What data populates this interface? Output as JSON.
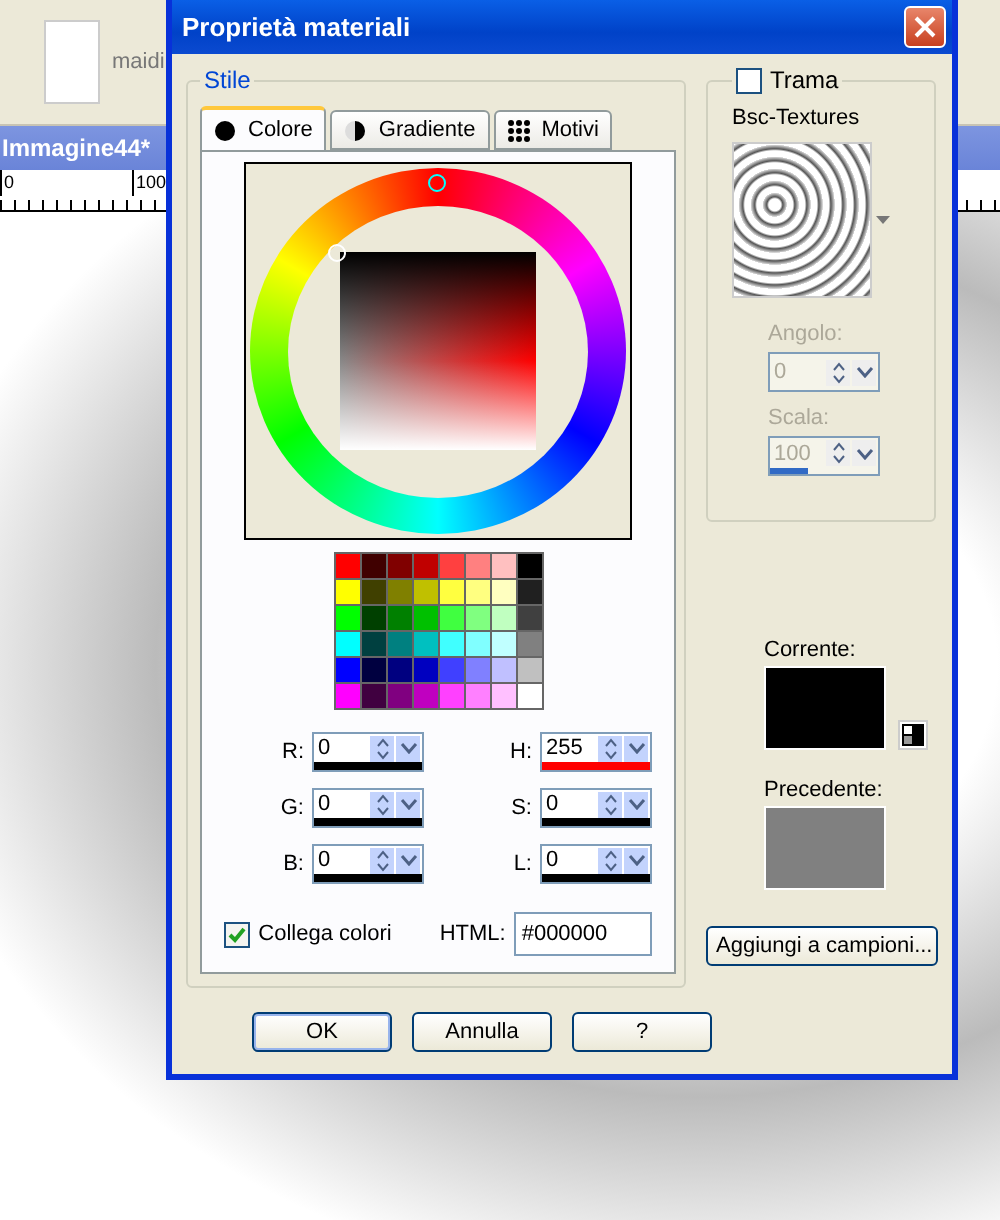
{
  "background_app": {
    "toolbar_text": "maidi",
    "document_tab": "Immagine44*",
    "ruler_labels": [
      "0",
      "100"
    ]
  },
  "dialog": {
    "title": "Proprietà materiali",
    "style_group": {
      "title": "Stile",
      "tabs": [
        {
          "label": "Colore",
          "selected": true,
          "kind": "color"
        },
        {
          "label": "Gradiente",
          "selected": false,
          "kind": "gradient"
        },
        {
          "label": "Motivi",
          "selected": false,
          "kind": "pattern"
        }
      ],
      "swatches": [
        {
          "color": "#ff0000"
        },
        {
          "color": "#400000"
        },
        {
          "color": "#800000"
        },
        {
          "color": "#c00000"
        },
        {
          "color": "#ff4040"
        },
        {
          "color": "#ff8080"
        },
        {
          "color": "#ffc0c0"
        },
        {
          "color": "#000000"
        },
        {
          "color": "#ffff00"
        },
        {
          "color": "#404000"
        },
        {
          "color": "#808000"
        },
        {
          "color": "#c0c000"
        },
        {
          "color": "#ffff40"
        },
        {
          "color": "#ffff80"
        },
        {
          "color": "#ffffc0"
        },
        {
          "color": "#202020"
        },
        {
          "color": "#00ff00"
        },
        {
          "color": "#004000"
        },
        {
          "color": "#008000"
        },
        {
          "color": "#00c000"
        },
        {
          "color": "#40ff40"
        },
        {
          "color": "#80ff80"
        },
        {
          "color": "#c0ffc0"
        },
        {
          "color": "#404040"
        },
        {
          "color": "#00ffff"
        },
        {
          "color": "#004040"
        },
        {
          "color": "#008080"
        },
        {
          "color": "#00c0c0"
        },
        {
          "color": "#40ffff"
        },
        {
          "color": "#80ffff"
        },
        {
          "color": "#c0ffff"
        },
        {
          "color": "#808080"
        },
        {
          "color": "#0000ff"
        },
        {
          "color": "#000040"
        },
        {
          "color": "#000080"
        },
        {
          "color": "#0000c0"
        },
        {
          "color": "#4040ff"
        },
        {
          "color": "#8080ff"
        },
        {
          "color": "#c0c0ff"
        },
        {
          "color": "#c0c0c0"
        },
        {
          "color": "#ff00ff"
        },
        {
          "color": "#400040"
        },
        {
          "color": "#800080"
        },
        {
          "color": "#c000c0"
        },
        {
          "color": "#ff40ff"
        },
        {
          "color": "#ff80ff"
        },
        {
          "color": "#ffc0ff"
        },
        {
          "color": "#ffffff"
        }
      ],
      "fields": [
        {
          "label": "R:",
          "value": "0",
          "color": "#000000"
        },
        {
          "label": "H:",
          "value": "255",
          "color": "#ff0000"
        },
        {
          "label": "G:",
          "value": "0",
          "color": "#000000"
        },
        {
          "label": "S:",
          "value": "0",
          "color": "#000000"
        },
        {
          "label": "B:",
          "value": "0",
          "color": "#000000"
        },
        {
          "label": "L:",
          "value": "0",
          "color": "#000000"
        }
      ],
      "link_colors": {
        "label": "Collega colori",
        "checked": true
      },
      "html": {
        "label": "HTML:",
        "value": "#000000"
      }
    },
    "texture_group": {
      "label": "Trama",
      "checked": false,
      "texture_name": "Bsc-Textures",
      "angle": {
        "label": "Angolo:",
        "value": "0",
        "disabled": true
      },
      "scale": {
        "label": "Scala:",
        "value": "100",
        "disabled": true,
        "level": 0.35
      }
    },
    "current": {
      "label": "Corrente:",
      "color": "#000000"
    },
    "previous": {
      "label": "Precedente:",
      "color": "#808080"
    },
    "add_button": "Aggiungi a campioni...",
    "buttons": [
      {
        "label": "OK",
        "default": true
      },
      {
        "label": "Annulla",
        "default": false
      },
      {
        "label": "?",
        "default": false
      }
    ]
  }
}
